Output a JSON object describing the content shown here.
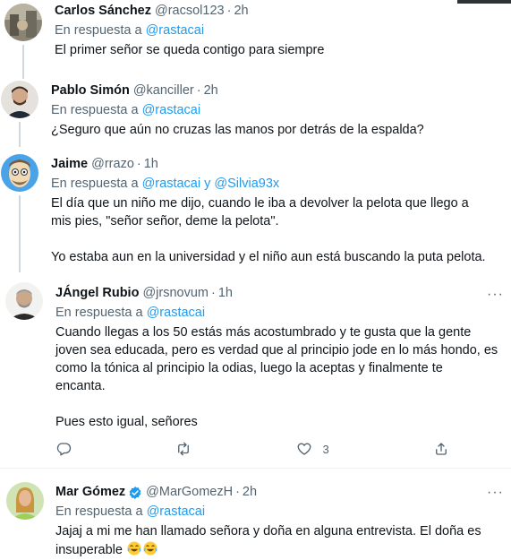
{
  "tweets": [
    {
      "name": "Carlos Sánchez",
      "handle": "@racsol123",
      "time": "2h",
      "reply_prefix": "En respuesta a",
      "mentions": [
        "@rastacai"
      ],
      "text": [
        "El primer señor se queda contigo para siempre"
      ]
    },
    {
      "name": "Pablo Simón",
      "handle": "@kanciller",
      "time": "2h",
      "reply_prefix": "En respuesta a",
      "mentions": [
        "@rastacai"
      ],
      "text": [
        "¿Seguro que aún no cruzas las manos por detrás de la espalda?"
      ]
    },
    {
      "name": "Jaime",
      "handle": "@rrazo",
      "time": "1h",
      "reply_prefix": "En respuesta a",
      "mentions": [
        "@rastacai",
        "@Silvia93x"
      ],
      "mention_joiner": "y",
      "text": [
        "El día que un niño me dijo, cuando le iba a devolver la pelota que llego a",
        "mis pies, \"señor señor, deme la pelota\".",
        "",
        "Yo estaba aun en la universidad y el niño aun está buscando la puta pelota."
      ]
    },
    {
      "name": "JÁngel Rubio",
      "handle": "@jrsnovum",
      "time": "1h",
      "reply_prefix": "En respuesta a",
      "mentions": [
        "@rastacai"
      ],
      "text": [
        "Cuando llegas a los 50 estás más acostumbrado y te gusta que la gente",
        "joven sea educada, pero es verdad que al principio jode en lo más hondo, es",
        "como la tónica al principio la odias, luego la aceptas y finalmente te",
        "encanta.",
        "",
        "Pues esto igual, señores"
      ],
      "more_label": "···",
      "actions": {
        "reply_icon": "reply-icon",
        "retweet_icon": "retweet-icon",
        "like_icon": "heart-icon",
        "like_count": "3",
        "share_icon": "share-icon"
      }
    },
    {
      "name": "Mar Gómez",
      "handle": "@MarGomezH",
      "time": "2h",
      "verified": true,
      "reply_prefix": "En respuesta a",
      "mentions": [
        "@rastacai"
      ],
      "text": [
        "Jajaj a mi me han llamado señora y doña en alguna entrevista. El doña es",
        "insuperable"
      ],
      "emoji": [
        "face-with-tears-of-joy",
        "face-with-tears-of-joy"
      ],
      "more_label": "···"
    }
  ],
  "colors": {
    "text": "#0f1419",
    "secondary": "#536471",
    "link": "#1d9bf0",
    "divider": "#eff3f4",
    "thread_line": "#cfd9de",
    "verified": "#1d9bf0"
  },
  "dot": "·"
}
